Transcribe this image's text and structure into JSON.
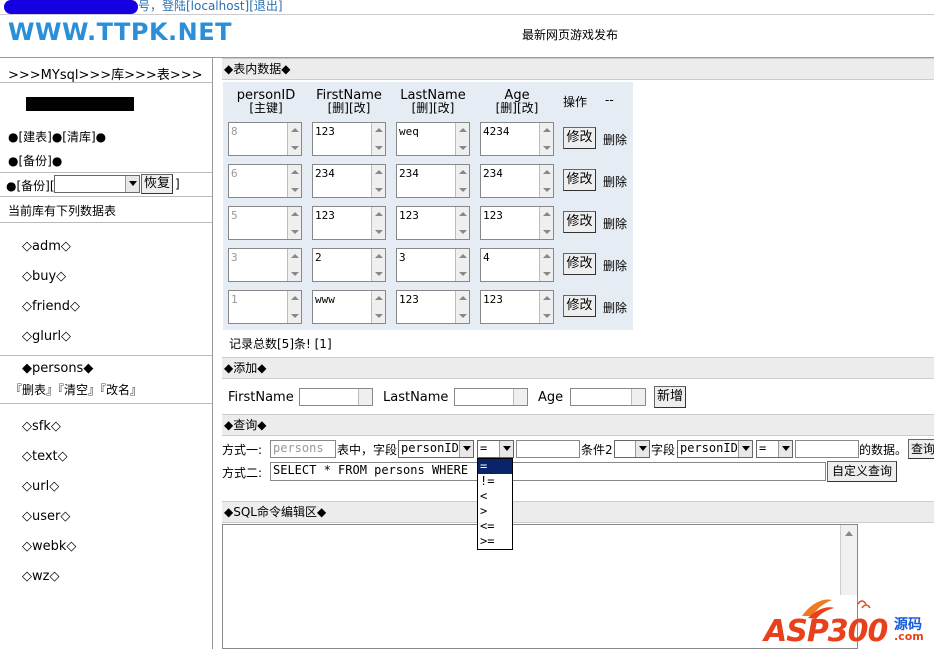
{
  "topbar": {
    "text": "号，登陆[localhost][退出]"
  },
  "header": {
    "logo": "WWW.TTPK.NET",
    "slogan": "最新网页游戏发布"
  },
  "sidebar": {
    "breadcrumb": ">>>MYsql>>>库>>>表>>>",
    "db_actions": "●[建表]●[清库]●",
    "backup": "●[备份]●",
    "restore_prefix": "●[备份][",
    "restore_button": "恢复",
    "restore_suffix": "]",
    "current_db_text": "当前库有下列数据表",
    "tables_a": [
      "◇adm◇",
      "◇buy◇",
      "◇friend◇",
      "◇glurl◇"
    ],
    "current_table": "◆persons◆",
    "current_table_actions": "『删表』『清空』『改名』",
    "tables_b": [
      "◇sfk◇",
      "◇text◇",
      "◇url◇",
      "◇user◇",
      "◇webk◇",
      "◇wz◇"
    ]
  },
  "data_section": {
    "title": "◆表内数据◆",
    "columns": [
      {
        "name": "personID",
        "sub": "[主键]"
      },
      {
        "name": "FirstName",
        "sub": "[删][改]"
      },
      {
        "name": "LastName",
        "sub": "[删][改]"
      },
      {
        "name": "Age",
        "sub": "[删][改]"
      }
    ],
    "op_header": "操作",
    "dash": "--",
    "rows": [
      {
        "id": "8",
        "first": "123",
        "last": "weq",
        "age": "4234"
      },
      {
        "id": "6",
        "first": "234",
        "last": "234",
        "age": "234"
      },
      {
        "id": "5",
        "first": "123",
        "last": "123",
        "age": "123"
      },
      {
        "id": "3",
        "first": "2",
        "last": "3",
        "age": "4"
      },
      {
        "id": "1",
        "first": "www",
        "last": "123",
        "age": "123"
      }
    ],
    "edit_label": "修改",
    "delete_label": "删除",
    "total_text": "记录总数[5]条! [1]"
  },
  "add_section": {
    "title": "◆添加◆",
    "labels": [
      "FirstName",
      "LastName",
      "Age"
    ],
    "add_button": "新增"
  },
  "query_section": {
    "title": "◆查询◆",
    "mode1_label": "方式一:",
    "table_placeholder": "persons",
    "in_table_text": "表中，字段",
    "field1": "personID",
    "op1": "=",
    "cond2_text": "条件2",
    "field_text": "字段",
    "field2": "personID",
    "op2": "=",
    "tail_text": "的数据。",
    "query_button": "查询",
    "mode2_label": "方式二:",
    "sql_value": "SELECT * FROM persons WHERE",
    "custom_query_button": "自定义查询",
    "operators": [
      "=",
      "!=",
      "<",
      ">",
      "<=",
      ">="
    ]
  },
  "sql_section": {
    "title": "◆SQL命令编辑区◆"
  },
  "watermark": {
    "brand": "ASP300",
    "sub": "源码",
    "dotcom": ".com"
  },
  "colors": {
    "logo": "#2a8fd8",
    "table_bg": "#e6ecf4",
    "highlight": "#0a246a",
    "watermark": "#e8401a"
  }
}
